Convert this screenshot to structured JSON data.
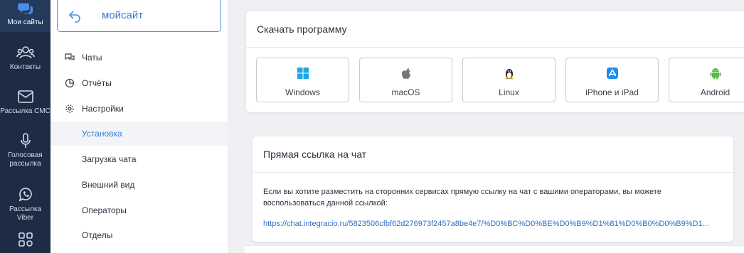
{
  "rail": {
    "items": [
      {
        "label": "Мои сайты",
        "icon": "chat-bubbles-icon"
      },
      {
        "label": "Контакты",
        "icon": "contacts-icon"
      },
      {
        "label": "Рассылка СМС",
        "icon": "envelope-icon"
      },
      {
        "label": "Голосовая рассылка",
        "icon": "microphone-icon"
      },
      {
        "label": "Рассылка Viber",
        "icon": "viber-icon"
      },
      {
        "label": "",
        "icon": "social-icon"
      }
    ]
  },
  "sidebar": {
    "site_name": "мойсайт",
    "items": [
      {
        "label": "Чаты",
        "icon": "chats-icon"
      },
      {
        "label": "Отчёты",
        "icon": "reports-icon"
      },
      {
        "label": "Настройки",
        "icon": "gear-icon"
      },
      {
        "label": "Установка"
      },
      {
        "label": "Загрузка чата"
      },
      {
        "label": "Внешний вид"
      },
      {
        "label": "Операторы"
      },
      {
        "label": "Отделы"
      }
    ]
  },
  "download": {
    "title": "Скачать программу",
    "platforms": [
      {
        "label": "Windows",
        "icon": "windows-icon",
        "color": "#1fa7e0"
      },
      {
        "label": "macOS",
        "icon": "apple-icon",
        "color": "#777777"
      },
      {
        "label": "Linux",
        "icon": "linux-icon",
        "color": "#222222"
      },
      {
        "label": "iPhone и iPad",
        "icon": "app-store-icon",
        "color": "#1a8cf0"
      },
      {
        "label": "Android",
        "icon": "android-icon",
        "color": "#55b84b"
      }
    ]
  },
  "direct_link": {
    "title": "Прямая ссылка на чат",
    "description": "Если вы хотите разместить на сторонних сервисах прямую ссылку на чат с вашими операторами, вы можете воспользоваться данной ссылкой:",
    "url": "https://chat.integracio.ru/5823506cfbf62d276973f2457a8be4e7/%D0%BC%D0%BE%D0%B9%D1%81%D0%B0%D0%B9%D1..."
  }
}
